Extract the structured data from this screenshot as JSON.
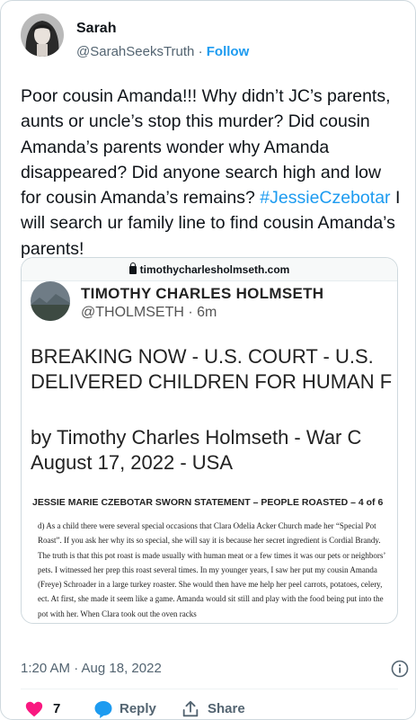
{
  "author": {
    "name": "Sarah",
    "handle": "@SarahSeeksTruth",
    "separator": "·",
    "follow_label": "Follow"
  },
  "tweet": {
    "text_before_hashtag": "Poor cousin Amanda!!! Why didn’t JC’s parents, aunts or uncle’s stop this murder? Did cousin Amanda’s parents wonder why Amanda disappeared? Did anyone search high and low for cousin Amanda’s remains?",
    "hashtag": "#JessieCzebotar",
    "text_after_hashtag": "I will search ur family line to find cousin Amanda’s parents!"
  },
  "media": {
    "url": "timothycharlesholmseth.com",
    "screenshot": {
      "name": "TIMOTHY CHARLES HOLMSETH",
      "handle": "@THOLMSETH · 6m",
      "headline_line1": "BREAKING NOW - U.S. COURT - U.S.",
      "headline_line2": "DELIVERED CHILDREN FOR HUMAN F",
      "byline_line1": "by Timothy Charles Holmseth - War C",
      "byline_line2": "August 17, 2022 - USA",
      "doc_title": "JESSIE MARIE CZEBOTAR SWORN STATEMENT – PEOPLE ROASTED – 4 of 6",
      "doc_body": "d) As a child there were several special occasions that Clara Odelia Acker Church made her “Special Pot Roast”. If you ask her why its so special, she will say it is because her secret ingredient is Cordial Brandy. The truth is that this pot roast is made usually with human meat or a few times it was our pets or neighbors’ pets. I witnessed her prep this roast several times. In my younger years, I saw her put my cousin Amanda (Freye) Schroader in a large turkey roaster. She would then have me help her peel carrots, potatoes, celery, ect. At first, she made it seem like a game. Amanda would sit still and play with the food being put into the pot with her. When Clara took out the oven racks"
    }
  },
  "meta": {
    "timestamp": "1:20 AM · Aug 18, 2022"
  },
  "actions": {
    "like_count": "7",
    "reply_label": "Reply",
    "share_label": "Share"
  },
  "colors": {
    "accent": "#1d9bf0",
    "like": "#f91880",
    "secondary_text": "#536471"
  }
}
